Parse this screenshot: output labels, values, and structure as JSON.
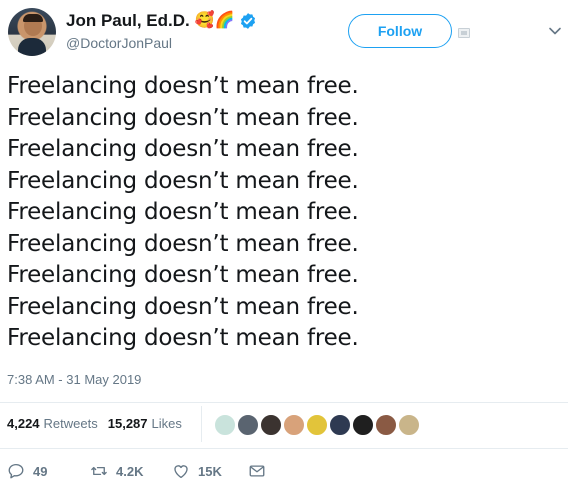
{
  "author": {
    "display_name": "Jon Paul, Ed.D.",
    "emoji": "🥰🌈",
    "handle": "@DoctorJonPaul",
    "verified": true
  },
  "follow_button": {
    "label": "Follow"
  },
  "tweet": {
    "lines": [
      "Freelancing doesn’t mean free.",
      "Freelancing doesn’t mean free.",
      "Freelancing doesn’t mean free.",
      "Freelancing doesn’t mean free.",
      "Freelancing doesn’t mean free.",
      "Freelancing doesn’t mean free.",
      "Freelancing doesn’t mean free.",
      "Freelancing doesn’t mean free.",
      "Freelancing doesn’t mean free."
    ],
    "timestamp": "7:38 AM - 31 May 2019"
  },
  "stats": {
    "retweets_count": "4,224",
    "retweets_label": "Retweets",
    "likes_count": "15,287",
    "likes_label": "Likes"
  },
  "liker_avatars": [
    {
      "color": "#c9e3dc"
    },
    {
      "color": "#5a6470"
    },
    {
      "color": "#3b3330"
    },
    {
      "color": "#d8a27a"
    },
    {
      "color": "#e2c43a"
    },
    {
      "color": "#2e3a52"
    },
    {
      "color": "#1f1f1f"
    },
    {
      "color": "#8a5a44"
    },
    {
      "color": "#c9b58a"
    }
  ],
  "actions": {
    "reply_count": "49",
    "retweet_count": "4.2K",
    "like_count": "15K"
  },
  "colors": {
    "accent": "#1da1f2",
    "verified": "#1da1f2",
    "secondary_text": "#657786",
    "divider": "#e6ecf0"
  },
  "icons": {
    "reply": "reply-icon",
    "retweet": "retweet-icon",
    "like": "heart-icon",
    "dm": "envelope-icon",
    "chevron": "chevron-down-icon",
    "verified": "verified-badge-icon"
  }
}
